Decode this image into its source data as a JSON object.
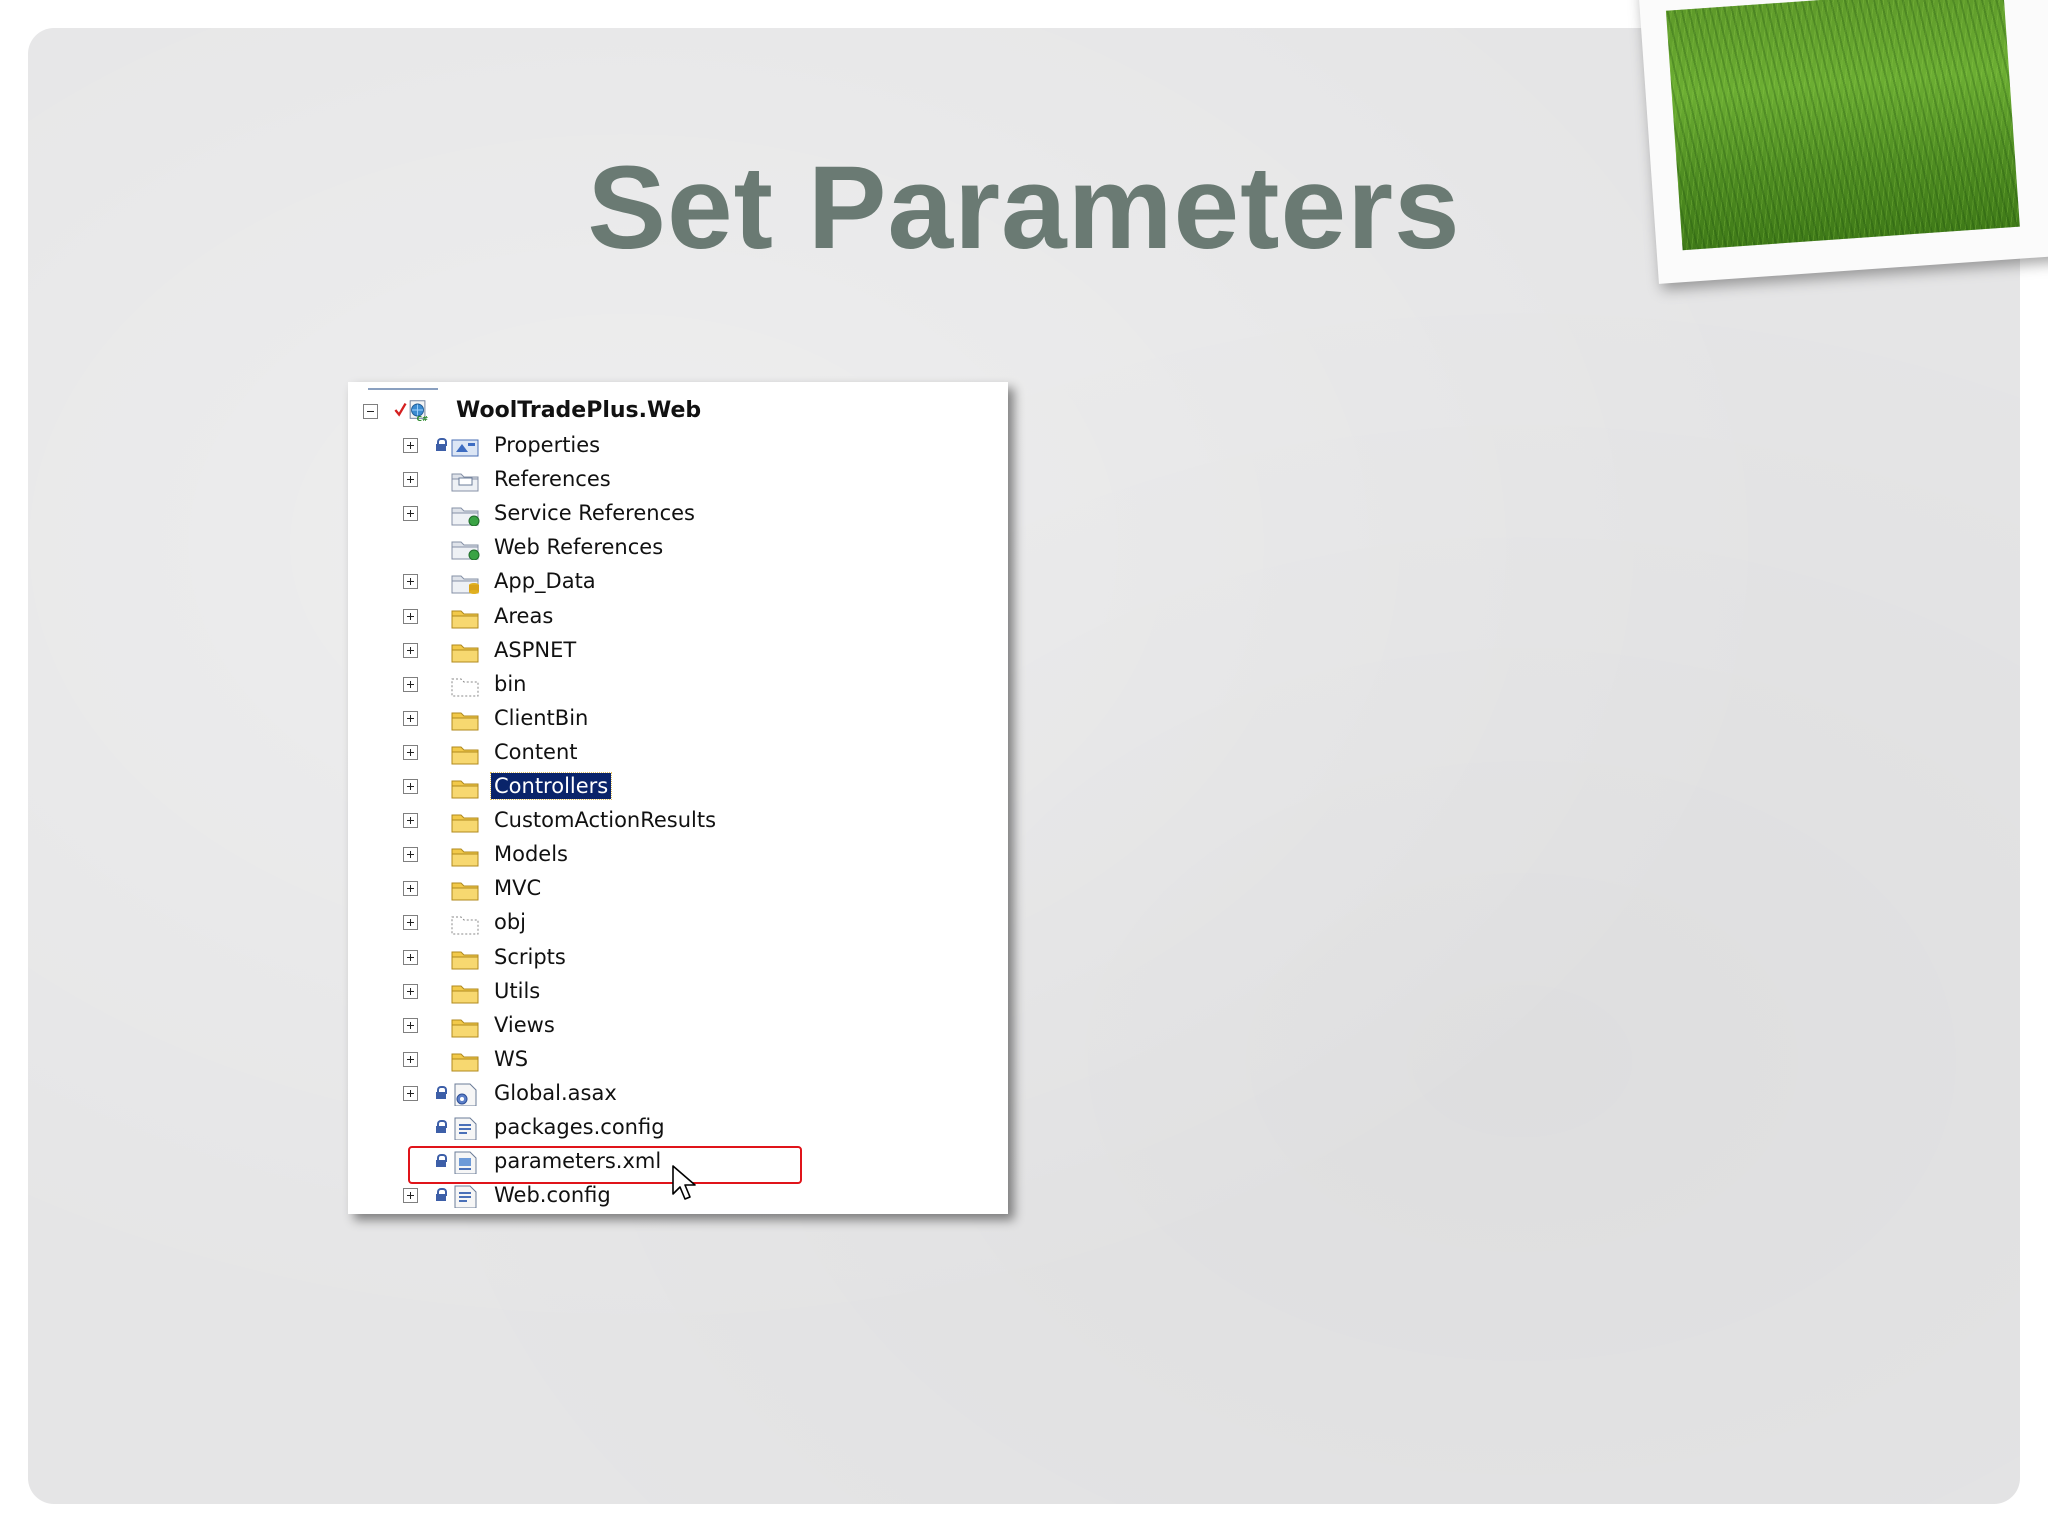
{
  "slide": {
    "title": "Set Parameters"
  },
  "solution_explorer": {
    "project": {
      "label": "WoolTradePlus.Web",
      "icon": "web-project-icon"
    },
    "items": [
      {
        "label": "Properties",
        "icon": "properties-icon",
        "expandable": true,
        "locked": true
      },
      {
        "label": "References",
        "icon": "references-folder-icon",
        "expandable": true,
        "locked": false
      },
      {
        "label": "Service References",
        "icon": "service-references-folder-icon",
        "expandable": true,
        "locked": false
      },
      {
        "label": "Web References",
        "icon": "web-references-folder-icon",
        "expandable": false,
        "locked": false
      },
      {
        "label": "App_Data",
        "icon": "app-data-folder-icon",
        "expandable": true,
        "locked": false
      },
      {
        "label": "Areas",
        "icon": "folder-icon",
        "expandable": true,
        "locked": false
      },
      {
        "label": "ASPNET",
        "icon": "folder-icon",
        "expandable": true,
        "locked": false
      },
      {
        "label": "bin",
        "icon": "excluded-folder-icon",
        "expandable": true,
        "locked": false
      },
      {
        "label": "ClientBin",
        "icon": "folder-icon",
        "expandable": true,
        "locked": false
      },
      {
        "label": "Content",
        "icon": "folder-icon",
        "expandable": true,
        "locked": false
      },
      {
        "label": "Controllers",
        "icon": "folder-icon",
        "expandable": true,
        "locked": false,
        "selected": true
      },
      {
        "label": "CustomActionResults",
        "icon": "folder-icon",
        "expandable": true,
        "locked": false
      },
      {
        "label": "Models",
        "icon": "folder-icon",
        "expandable": true,
        "locked": false
      },
      {
        "label": "MVC",
        "icon": "folder-icon",
        "expandable": true,
        "locked": false
      },
      {
        "label": "obj",
        "icon": "excluded-folder-icon",
        "expandable": true,
        "locked": false
      },
      {
        "label": "Scripts",
        "icon": "folder-icon",
        "expandable": true,
        "locked": false
      },
      {
        "label": "Utils",
        "icon": "folder-icon",
        "expandable": true,
        "locked": false
      },
      {
        "label": "Views",
        "icon": "folder-icon",
        "expandable": true,
        "locked": false
      },
      {
        "label": "WS",
        "icon": "folder-icon",
        "expandable": true,
        "locked": false
      },
      {
        "label": "Global.asax",
        "icon": "global-asax-file-icon",
        "expandable": true,
        "locked": true
      },
      {
        "label": "packages.config",
        "icon": "config-file-icon",
        "expandable": false,
        "locked": true
      },
      {
        "label": "parameters.xml",
        "icon": "xml-file-icon",
        "expandable": false,
        "locked": true,
        "highlighted": true
      },
      {
        "label": "Web.config",
        "icon": "config-file-icon",
        "expandable": true,
        "locked": true
      }
    ]
  },
  "colors": {
    "title": "#6a7a73",
    "folder": "#f2c94a",
    "selection": "#0a246a",
    "highlight": "#e0141a",
    "lock": "#3d5fa8"
  }
}
